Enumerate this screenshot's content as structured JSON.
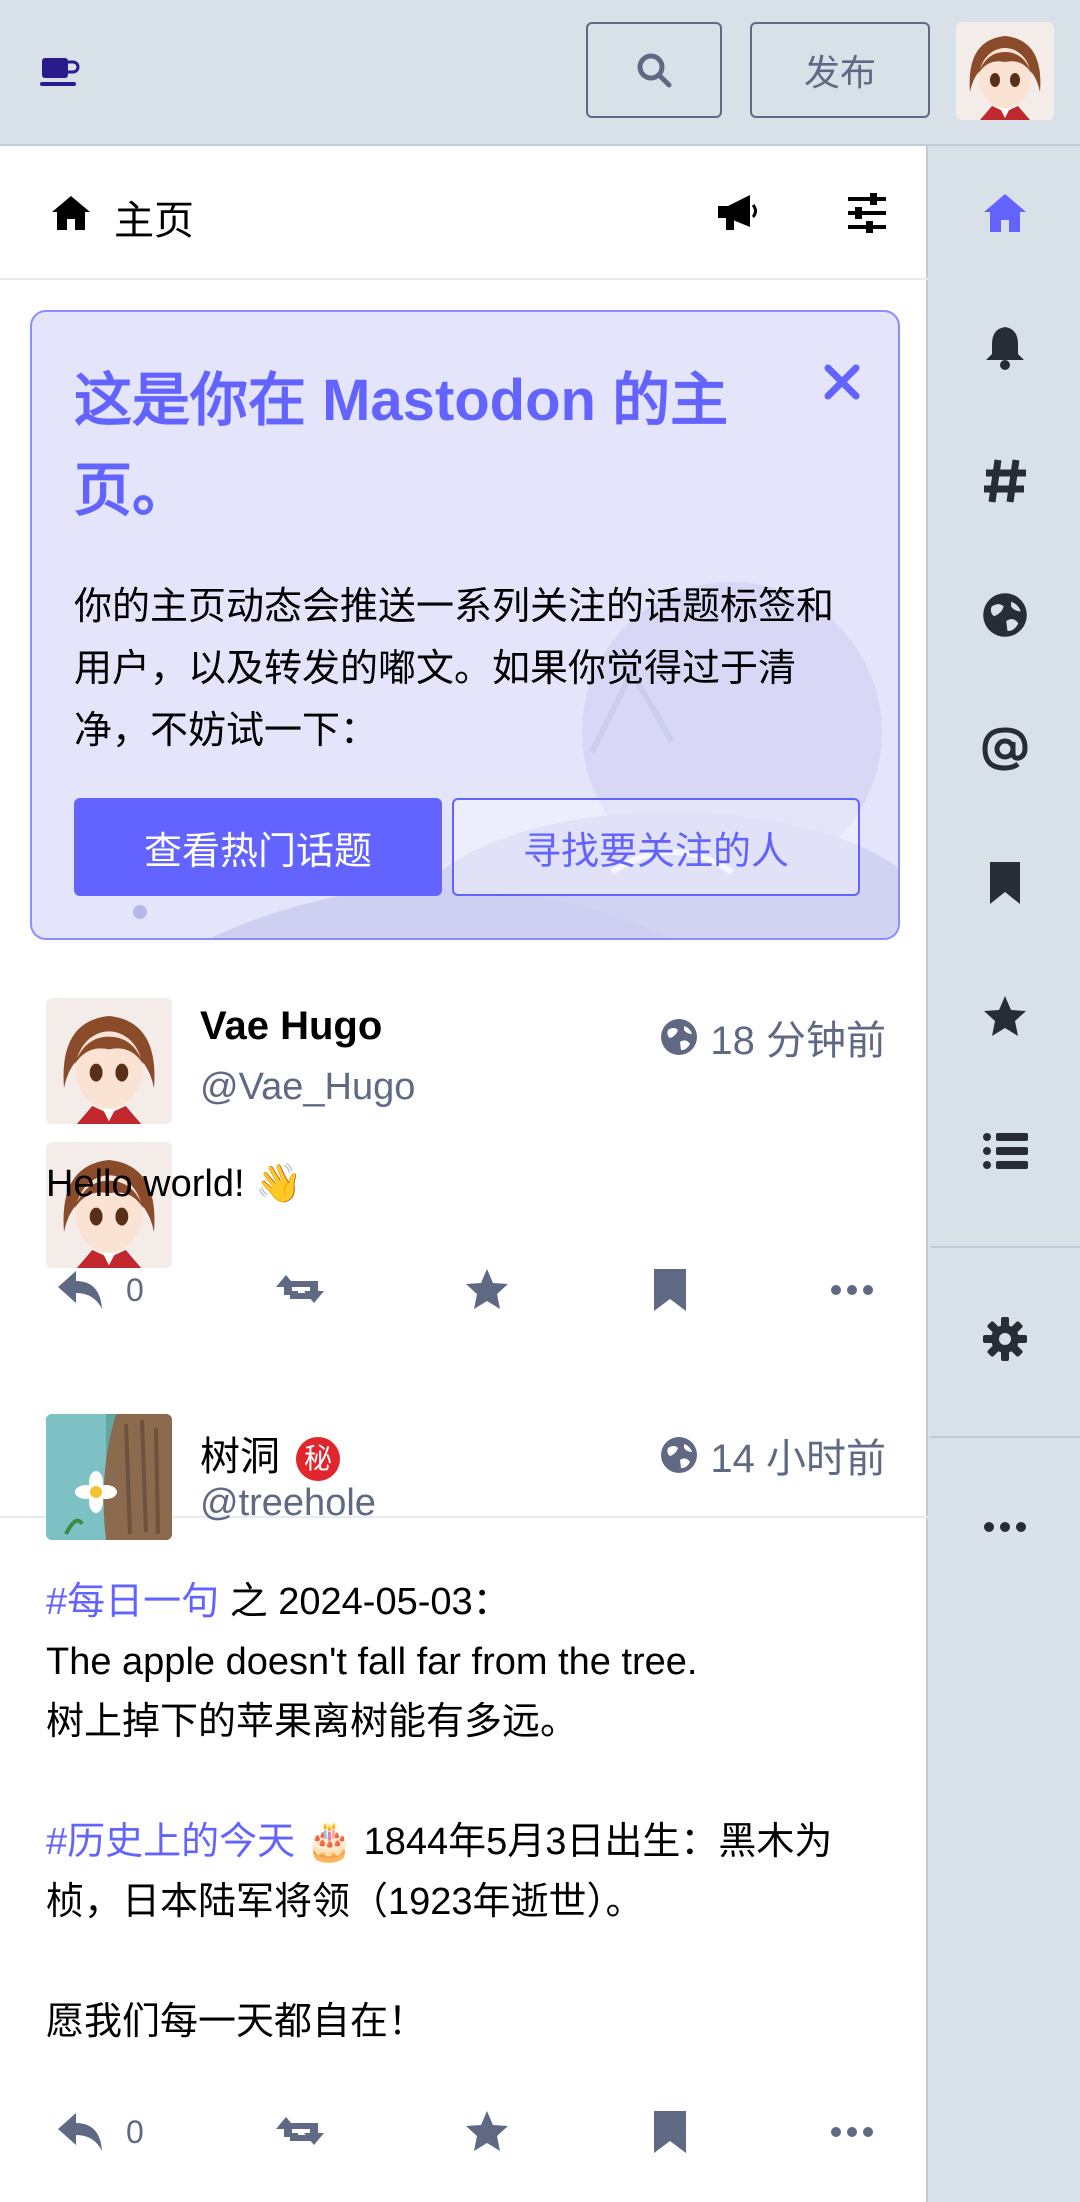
{
  "app": {
    "accent": "#6364ff",
    "muted": "#606984",
    "logo_icon": "coffee-mug-icon"
  },
  "topbar": {
    "search_icon": "search-icon",
    "publish_label": "发布",
    "avatar": "user-avatar"
  },
  "column": {
    "title": "主页",
    "icons": [
      "home-icon",
      "megaphone-icon",
      "sliders-icon"
    ]
  },
  "banner": {
    "title": "这是你在 Mastodon 的主页。",
    "text": "你的主页动态会推送一系列关注的话题标签和用户，以及转发的嘟文。如果你觉得过于清净，不妨试一下：",
    "trending_label": "查看热门话题",
    "follow_label": "寻找要关注的人"
  },
  "statuses": [
    {
      "display_name": "Vae Hugo",
      "handle": "@Vae_Hugo",
      "time": "18 分钟前",
      "content": "Hello world! 👋",
      "replies": "0"
    },
    {
      "display_name": "树洞",
      "secret_badge": "秘",
      "handle": "@treehole",
      "time": "14 小时前",
      "tag1": "#每日一句",
      "line1_rest": " 之 2024-05-03：",
      "line2": "The apple doesn't fall far from the tree.",
      "line3": "树上掉下的苹果离树能有多远。",
      "tag2": "#历史上的今天",
      "line4_rest": " 🎂 1844年5月3日出生：黑木为桢，日本陆军将领（1923年逝世）。",
      "line5": "愿我们每一天都自在！",
      "replies": "0"
    }
  ],
  "nav": [
    "home-icon",
    "bell-icon",
    "hashtag-icon",
    "globe-icon",
    "at-icon",
    "bookmark-icon",
    "star-icon",
    "list-icon",
    "gear-icon",
    "ellipsis-icon"
  ]
}
